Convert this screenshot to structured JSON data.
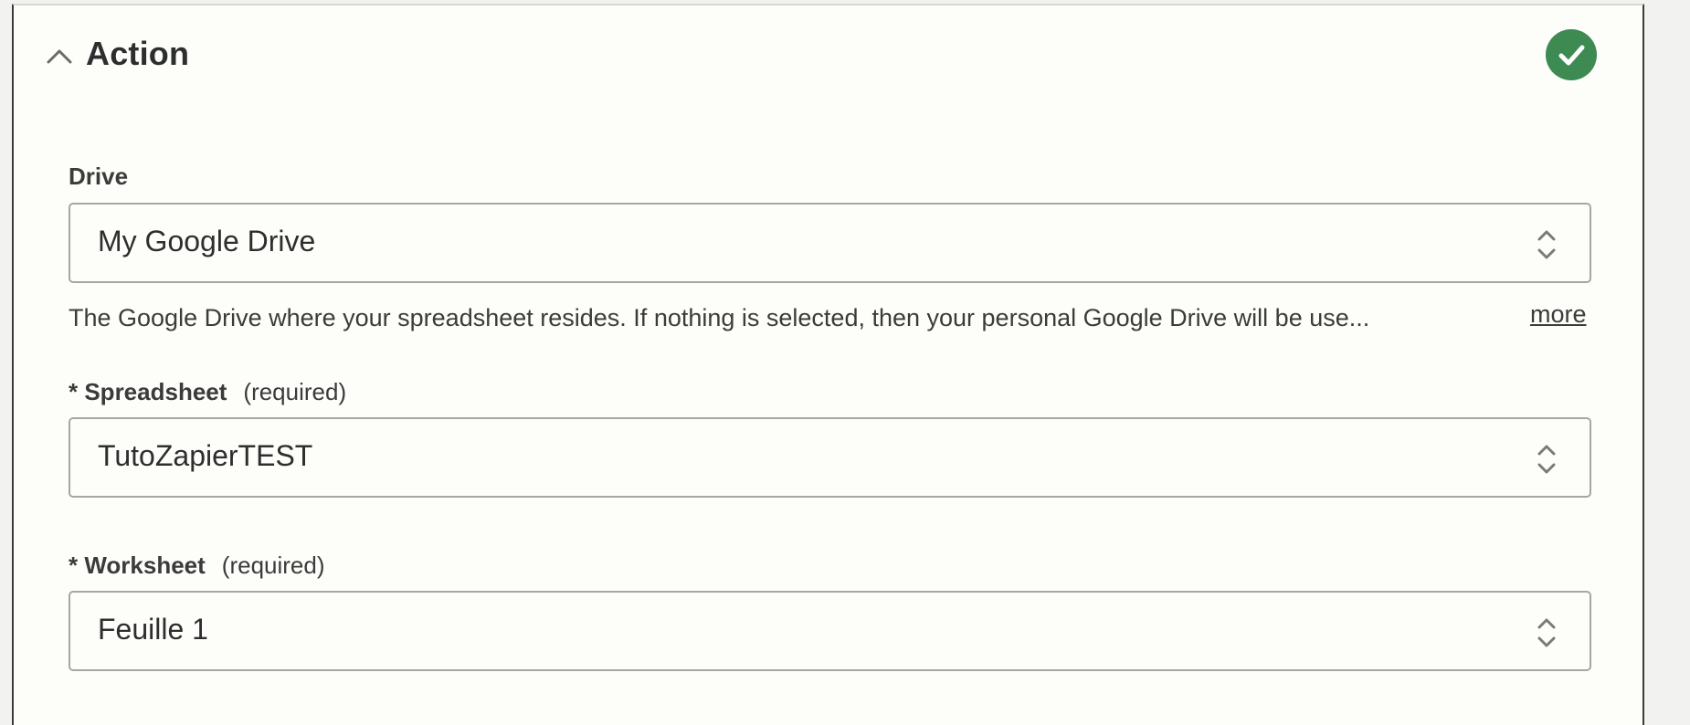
{
  "section": {
    "title": "Action",
    "status": "complete"
  },
  "fields": {
    "drive": {
      "label": "Drive",
      "value": "My Google Drive",
      "help": "The Google Drive where your spreadsheet resides. If nothing is selected, then your personal Google Drive will be use...",
      "more_label": "more"
    },
    "spreadsheet": {
      "label": "* Spreadsheet",
      "required_label": "(required)",
      "value": "TutoZapierTEST"
    },
    "worksheet": {
      "label": "* Worksheet",
      "required_label": "(required)",
      "value": "Feuille 1"
    }
  },
  "icons": {
    "collapse": "chevron-up-icon",
    "status": "check-circle-icon",
    "select": "chevron-up-down-icon"
  },
  "colors": {
    "success": "#3d8a53",
    "border": "#a7a7a2",
    "background": "#fdfdfa"
  }
}
